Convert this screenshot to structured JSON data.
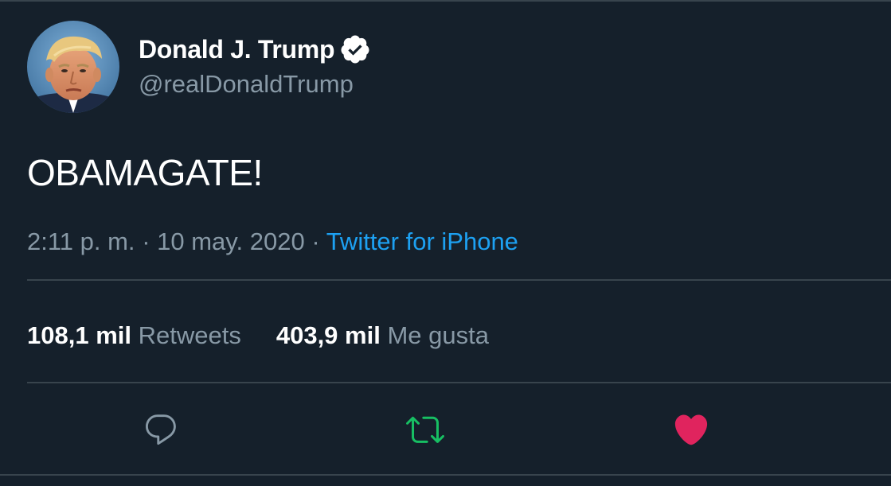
{
  "tweet": {
    "author": {
      "display_name": "Donald J. Trump",
      "handle": "@realDonaldTrump",
      "verified": true
    },
    "text": "OBAMAGATE!",
    "time": "2:11 p. m.",
    "separator": "·",
    "date": "10 may. 2020",
    "source": "Twitter for iPhone",
    "stats": {
      "retweets_count": "108,1 mil",
      "retweets_label": "Retweets",
      "likes_count": "403,9 mil",
      "likes_label": "Me gusta"
    }
  },
  "actions": {
    "reply_icon": "reply-icon",
    "retweet_icon": "retweet-icon",
    "like_icon": "heart-icon",
    "retweet_active": true,
    "like_active": true
  },
  "colors": {
    "background": "#15202b",
    "primary_text": "#ffffff",
    "secondary_text": "#8899a6",
    "link": "#1da1f2",
    "retweet_active": "#17bf63",
    "like_active": "#e0245e",
    "divider": "#38444d"
  }
}
